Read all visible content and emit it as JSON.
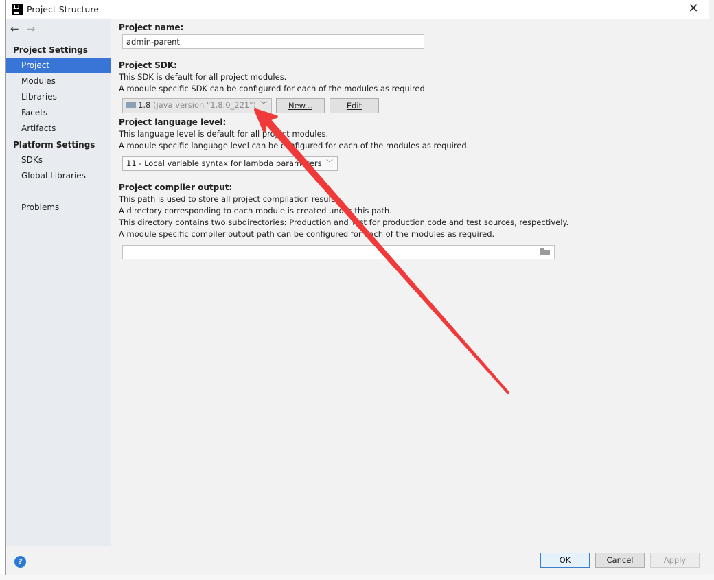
{
  "window": {
    "title": "Project Structure",
    "close_glyph": "✕",
    "app_icon_text": "IJ"
  },
  "sidebar": {
    "back_glyph": "←",
    "forward_glyph": "→",
    "project_settings_title": "Project Settings",
    "platform_settings_title": "Platform Settings",
    "items": [
      {
        "label": "Project",
        "selected": true
      },
      {
        "label": "Modules"
      },
      {
        "label": "Libraries"
      },
      {
        "label": "Facets"
      },
      {
        "label": "Artifacts"
      },
      {
        "label": "SDKs"
      },
      {
        "label": "Global Libraries"
      },
      {
        "label": "Problems"
      }
    ]
  },
  "project_name": {
    "label": "Project name:",
    "value": "admin-parent"
  },
  "sdk": {
    "label": "Project SDK:",
    "desc1": "This SDK is default for all project modules.",
    "desc2": "A module specific SDK can be configured for each of the modules as required.",
    "selected_version": "1.8",
    "selected_detail": "(java version \"1.8.0_221\")",
    "new_button": "New...",
    "edit_button": "Edit"
  },
  "language_level": {
    "label": "Project language level:",
    "desc1": "This language level is default for all project modules.",
    "desc2": "A module specific language level can be configured for each of the modules as required.",
    "selected": "11 - Local variable syntax for lambda parameters"
  },
  "compiler_output": {
    "label": "Project compiler output:",
    "desc1": "This path is used to store all project compilation results.",
    "desc2": "A directory corresponding to each module is created under this path.",
    "desc3": "This directory contains two subdirectories: Production and Test for production code and test sources, respectively.",
    "desc4": "A module specific compiler output path can be configured for each of the modules as required.",
    "value": ""
  },
  "footer": {
    "help_glyph": "?",
    "ok": "OK",
    "cancel": "Cancel",
    "apply": "Apply"
  },
  "colors": {
    "selection": "#3875d7",
    "annotation_arrow": "#f03a3a"
  }
}
